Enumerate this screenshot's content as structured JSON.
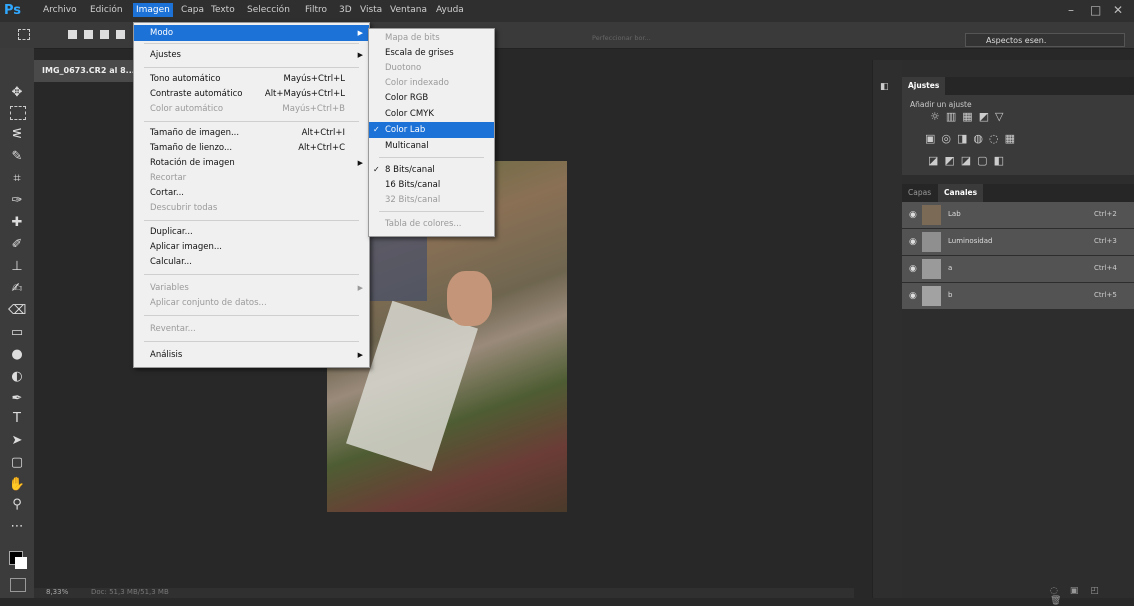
{
  "menubar": {
    "logo": "Ps",
    "items": [
      "Archivo",
      "Edición",
      "Imagen",
      "Capa",
      "Texto",
      "Selección",
      "Filtro",
      "3D",
      "Vista",
      "Ventana",
      "Ayuda"
    ],
    "active_index": 2
  },
  "window_controls": {
    "minimize": "–",
    "restore": "□",
    "close": "✕"
  },
  "options_bar": {
    "refine_label": "Perfeccionar bor...",
    "workspace": "Aspectos esen."
  },
  "document": {
    "tab_label": "IMG_0673.CR2 al 8...",
    "zoom": "8,33%",
    "doc_info": "Doc: 51,3 MB/51,3 MB"
  },
  "image_menu": {
    "items": [
      {
        "label": "Modo",
        "shortcut": "",
        "submenu": true,
        "disabled": false,
        "highlight": true
      },
      {
        "label": "Ajustes",
        "shortcut": "",
        "submenu": true,
        "disabled": false
      },
      {
        "label": "Tono automático",
        "shortcut": "Mayús+Ctrl+L",
        "submenu": false,
        "disabled": false
      },
      {
        "label": "Contraste automático",
        "shortcut": "Alt+Mayús+Ctrl+L",
        "submenu": false,
        "disabled": false
      },
      {
        "label": "Color automático",
        "shortcut": "Mayús+Ctrl+B",
        "submenu": false,
        "disabled": true
      },
      {
        "label": "Tamaño de imagen...",
        "shortcut": "Alt+Ctrl+I",
        "submenu": false,
        "disabled": false
      },
      {
        "label": "Tamaño de lienzo...",
        "shortcut": "Alt+Ctrl+C",
        "submenu": false,
        "disabled": false
      },
      {
        "label": "Rotación de imagen",
        "shortcut": "",
        "submenu": true,
        "disabled": false
      },
      {
        "label": "Recortar",
        "shortcut": "",
        "submenu": false,
        "disabled": true
      },
      {
        "label": "Cortar...",
        "shortcut": "",
        "submenu": false,
        "disabled": false
      },
      {
        "label": "Descubrir todas",
        "shortcut": "",
        "submenu": false,
        "disabled": true
      },
      {
        "label": "Duplicar...",
        "shortcut": "",
        "submenu": false,
        "disabled": false
      },
      {
        "label": "Aplicar imagen...",
        "shortcut": "",
        "submenu": false,
        "disabled": false
      },
      {
        "label": "Calcular...",
        "shortcut": "",
        "submenu": false,
        "disabled": false
      },
      {
        "label": "Variables",
        "shortcut": "",
        "submenu": true,
        "disabled": true
      },
      {
        "label": "Aplicar conjunto de datos...",
        "shortcut": "",
        "submenu": false,
        "disabled": true
      },
      {
        "label": "Reventar...",
        "shortcut": "",
        "submenu": false,
        "disabled": true
      },
      {
        "label": "Análisis",
        "shortcut": "",
        "submenu": true,
        "disabled": false
      }
    ]
  },
  "mode_menu": {
    "items": [
      {
        "label": "Mapa de bits",
        "disabled": true,
        "checked": false
      },
      {
        "label": "Escala de grises",
        "disabled": false,
        "checked": false
      },
      {
        "label": "Duotono",
        "disabled": true,
        "checked": false
      },
      {
        "label": "Color indexado",
        "disabled": true,
        "checked": false
      },
      {
        "label": "Color RGB",
        "disabled": false,
        "checked": false
      },
      {
        "label": "Color CMYK",
        "disabled": false,
        "checked": false
      },
      {
        "label": "Color Lab",
        "disabled": false,
        "checked": true,
        "highlight": true
      },
      {
        "label": "Multicanal",
        "disabled": false,
        "checked": false
      },
      {
        "label": "8 Bits/canal",
        "disabled": false,
        "checked": true
      },
      {
        "label": "16 Bits/canal",
        "disabled": false,
        "checked": false
      },
      {
        "label": "32 Bits/canal",
        "disabled": true,
        "checked": false
      },
      {
        "label": "Tabla de colores...",
        "disabled": true,
        "checked": false
      }
    ]
  },
  "adjustments_panel": {
    "tab": "Ajustes",
    "title": "Añadir un ajuste"
  },
  "channels_panel": {
    "tabs": [
      "Capas",
      "Canales"
    ],
    "active_tab": 1,
    "channels": [
      {
        "name": "Lab",
        "shortcut": "Ctrl+2"
      },
      {
        "name": "Luminosidad",
        "shortcut": "Ctrl+3"
      },
      {
        "name": "a",
        "shortcut": "Ctrl+4"
      },
      {
        "name": "b",
        "shortcut": "Ctrl+5"
      }
    ]
  }
}
